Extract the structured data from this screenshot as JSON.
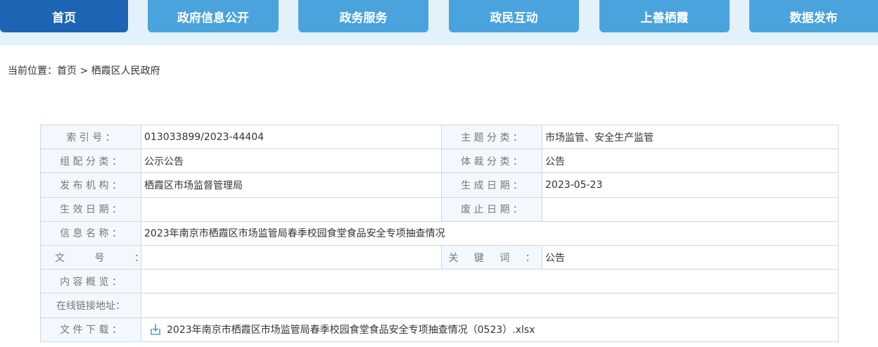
{
  "nav": {
    "items": [
      {
        "label": "首页",
        "active": true
      },
      {
        "label": "政府信息公开",
        "active": false
      },
      {
        "label": "政务服务",
        "active": false
      },
      {
        "label": "政民互动",
        "active": false
      },
      {
        "label": "上善栖霞",
        "active": false
      },
      {
        "label": "数据发布",
        "active": false
      }
    ],
    "colors": {
      "active": "#1d64b5",
      "normal": "#4ba3dd",
      "bar": "#e3f1fb"
    }
  },
  "breadcrumb": {
    "prefix": "当前位置：",
    "home": "首页",
    "sep": " > ",
    "current": "栖霞区人民政府"
  },
  "meta": {
    "index_label": "索 引 号 ：",
    "index_value": "013033899/2023-44404",
    "topic_label": "主 题 分 类 ：",
    "topic_value": "市场监管、安全生产监管",
    "group_label": "组 配 分 类 ：",
    "group_value": "公示公告",
    "genre_label": "体 裁 分 类 ：",
    "genre_value": "公告",
    "issuer_label": "发 布 机 构 ：",
    "issuer_value": "栖霞区市场监督管理局",
    "created_label": "生 成 日 期 ：",
    "created_value": "2023-05-23",
    "effective_label": "生 效 日 期 ：",
    "effective_value": "",
    "expiry_label": "废 止 日 期 ：",
    "expiry_value": "",
    "name_label": "信 息 名 称 ：",
    "name_value": "2023年南京市栖霞区市场监管局春季校园食堂食品安全专项抽查情况",
    "docno_label": "文 号 ：",
    "docno_value": "",
    "keyword_label": "关 键 词 ：",
    "keyword_value": "公告",
    "summary_label": "内 容 概 览 ：",
    "summary_value": "",
    "link_label": "在线链接地址：",
    "link_value": "",
    "download_label": "文 件 下 载 ：",
    "download_file": "2023年南京市栖霞区市场监管局春季校园食堂食品安全专项抽查情况（0523）.xlsx",
    "download_icon": "download-file-icon"
  }
}
